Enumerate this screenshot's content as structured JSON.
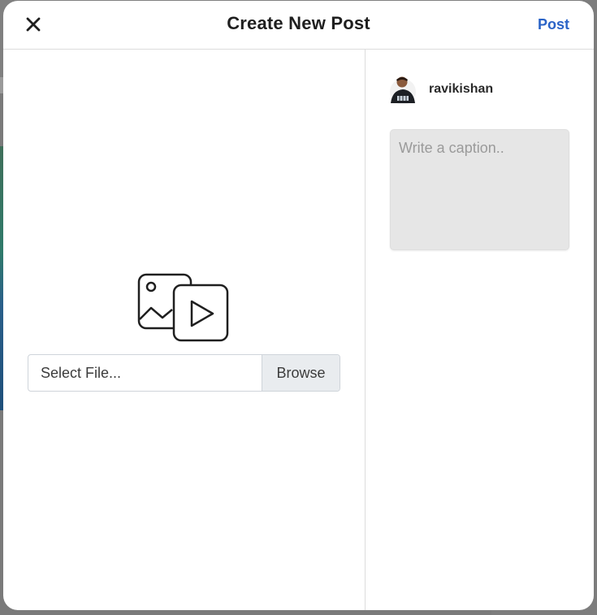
{
  "header": {
    "title": "Create New Post",
    "post_label": "Post",
    "close_icon": "close-icon"
  },
  "upload": {
    "media_icon": "photo-video-icon",
    "file_placeholder": "Select File...",
    "browse_label": "Browse"
  },
  "profile": {
    "username": "ravikishan"
  },
  "caption": {
    "placeholder": "Write a caption.."
  },
  "colors": {
    "accent": "#2a63c7",
    "caption_bg": "#e6e6e6",
    "browse_bg": "#e9ecef"
  }
}
